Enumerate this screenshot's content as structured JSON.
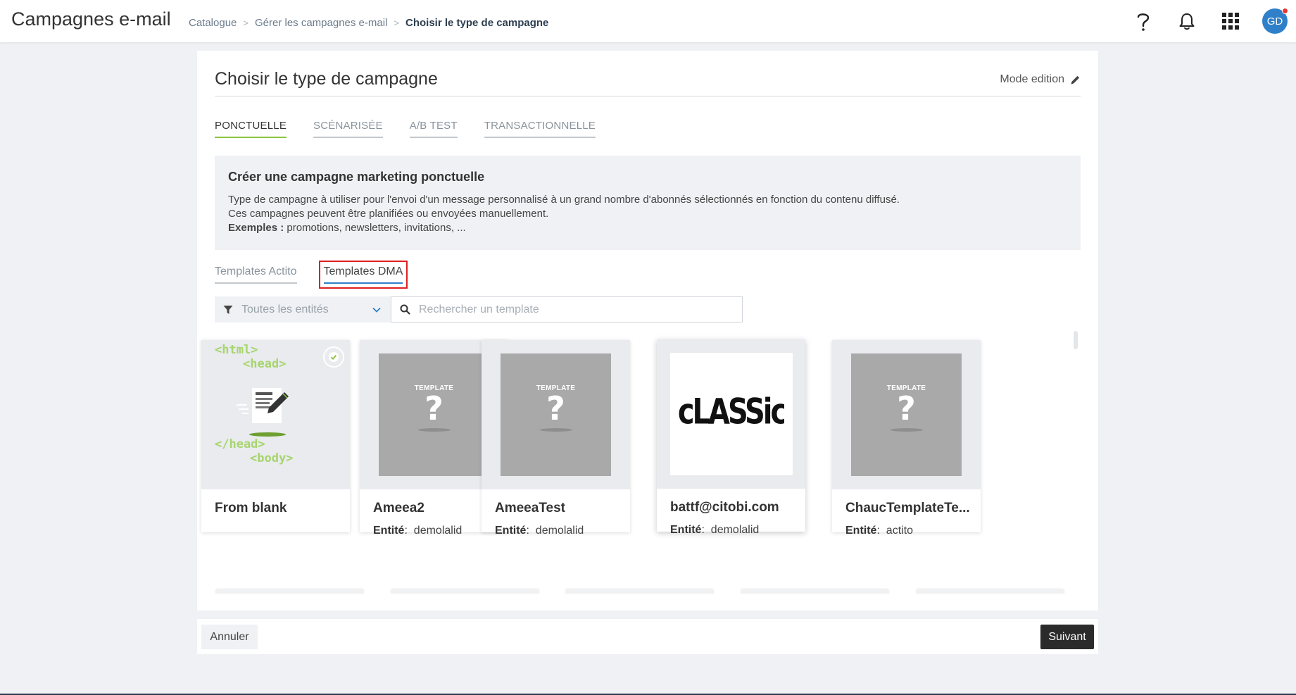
{
  "header": {
    "app_title": "Campagnes e-mail",
    "breadcrumb": [
      "Catalogue",
      "Gérer les campagnes e-mail",
      "Choisir le type de campagne"
    ],
    "icons": [
      "help-icon",
      "bell-icon",
      "apps-grid-icon"
    ],
    "avatar_initials": "GD"
  },
  "page": {
    "title": "Choisir le type de campagne",
    "mode_edition": "Mode edition"
  },
  "tabs": [
    "PONCTUELLE",
    "SCÉNARISÉE",
    "A/B TEST",
    "TRANSACTIONNELLE"
  ],
  "info": {
    "title": "Créer une campagne marketing ponctuelle",
    "line1": "Type de campagne à utiliser pour l'envoi d'un message personnalisé à un grand nombre d'abonnés sélectionnés en fonction du contenu diffusé.",
    "line2": "Ces campagnes peuvent être planifiées ou envoyées manuellement.",
    "examples_label": "Exemples :",
    "examples_text": " promotions, newsletters, invitations, ..."
  },
  "subtabs": [
    "Templates Actito",
    "Templates DMA"
  ],
  "filter": {
    "label": "Toutes les entités"
  },
  "search": {
    "placeholder": "Rechercher un template",
    "value": ""
  },
  "entity_label": "Entité",
  "placeholder_text": "TEMPLATE",
  "placeholder_mark": "?",
  "blank_code": [
    "<html>",
    "<head>",
    "</head>",
    "<body>"
  ],
  "classic_logo": "cLASSic",
  "cards": [
    {
      "name": "From blank",
      "entity": ""
    },
    {
      "name": "Ameea2",
      "entity": "demolalid"
    },
    {
      "name": "AmeeaTest",
      "entity": "demolalid"
    },
    {
      "name": "battf@citobi.com",
      "entity": "demolalid"
    },
    {
      "name": "ChaucTemplateTe...",
      "entity": "actito"
    }
  ],
  "footer": {
    "cancel": "Annuler",
    "next": "Suivant"
  },
  "colors": {
    "accent_green": "#8dc63f",
    "accent_blue": "#2f80c9",
    "highlight_red": "#e02020",
    "dark_button": "#2b2b2b"
  }
}
